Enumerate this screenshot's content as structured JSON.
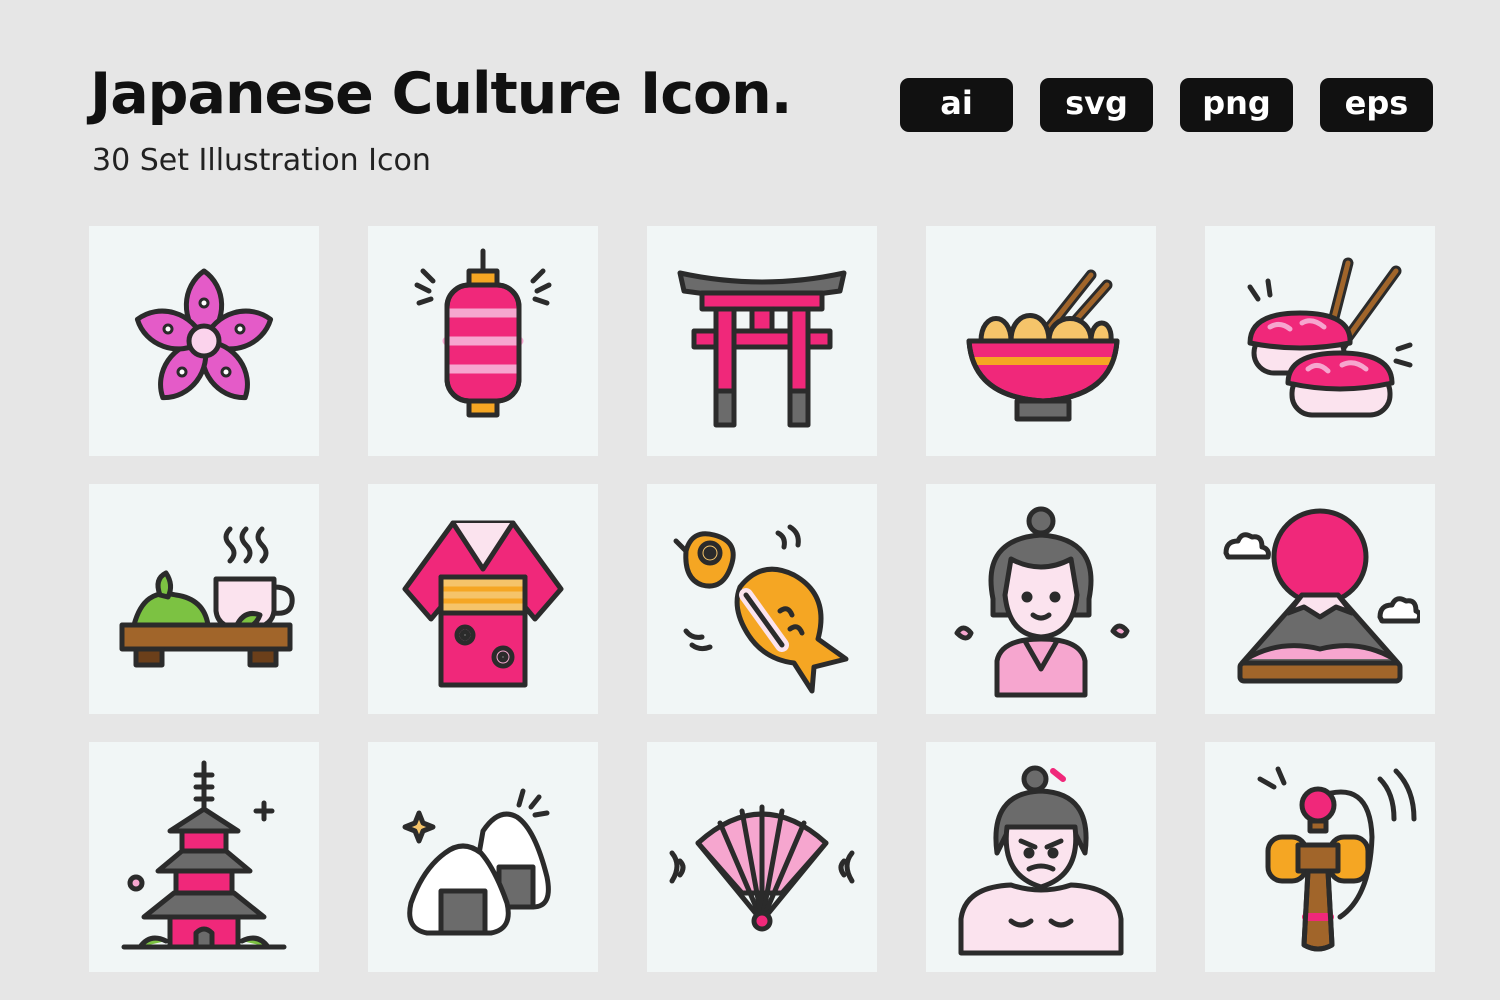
{
  "header": {
    "title": "Japanese Culture Icon.",
    "subtitle": "30 Set Illustration Icon",
    "formats": [
      "ai",
      "svg",
      "png",
      "eps"
    ]
  },
  "icons": [
    "sakura-flower-icon",
    "paper-lantern-icon",
    "torii-gate-icon",
    "ramen-bowl-icon",
    "sushi-chopsticks-icon",
    "green-tea-icon",
    "kimono-icon",
    "taiyaki-icon",
    "geisha-icon",
    "mount-fuji-icon",
    "pagoda-icon",
    "onigiri-icon",
    "folding-fan-icon",
    "sumo-wrestler-icon",
    "kendama-icon"
  ],
  "colors": {
    "background": "#e6e6e6",
    "tile": "#f1f6f6",
    "outline": "#2b2b2b",
    "pink": "#f0287a",
    "light_pink": "#f6a6cf",
    "orange": "#f5a623",
    "grey": "#6b6b6b"
  }
}
